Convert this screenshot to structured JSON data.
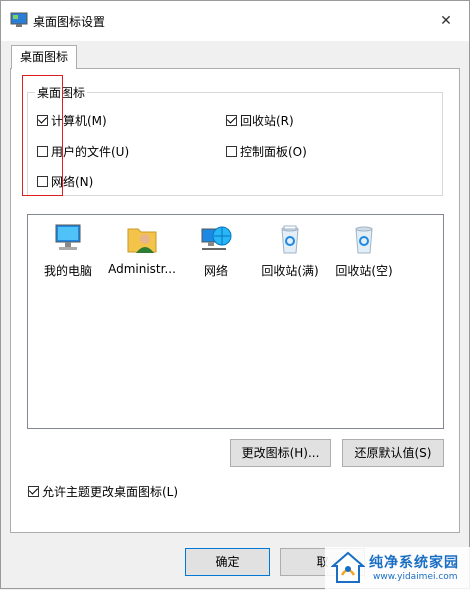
{
  "window": {
    "title": "桌面图标设置",
    "close_symbol": "✕"
  },
  "tab": {
    "label": "桌面图标"
  },
  "group": {
    "label": "桌面图标",
    "checkboxes": [
      {
        "label": "计算机(M)",
        "checked": true
      },
      {
        "label": "回收站(R)",
        "checked": true
      },
      {
        "label": "用户的文件(U)",
        "checked": false
      },
      {
        "label": "控制面板(O)",
        "checked": false
      },
      {
        "label": "网络(N)",
        "checked": false
      }
    ]
  },
  "icons": [
    {
      "label": "我的电脑",
      "icon": "computer-icon"
    },
    {
      "label": "Administr...",
      "icon": "user-folder-icon"
    },
    {
      "label": "网络",
      "icon": "network-icon"
    },
    {
      "label": "回收站(满)",
      "icon": "recycle-bin-full-icon"
    },
    {
      "label": "回收站(空)",
      "icon": "recycle-bin-empty-icon"
    }
  ],
  "buttons": {
    "change_icon": "更改图标(H)...",
    "restore_default": "还原默认值(S)",
    "ok": "确定",
    "cancel": "取"
  },
  "allow_themes": {
    "label": "允许主题更改桌面图标(L)",
    "checked": true
  },
  "watermark": {
    "title": "纯净系统家园",
    "url": "www.yidaimei.com"
  },
  "colors": {
    "accent": "#0078d7",
    "highlight": "#e02020"
  }
}
